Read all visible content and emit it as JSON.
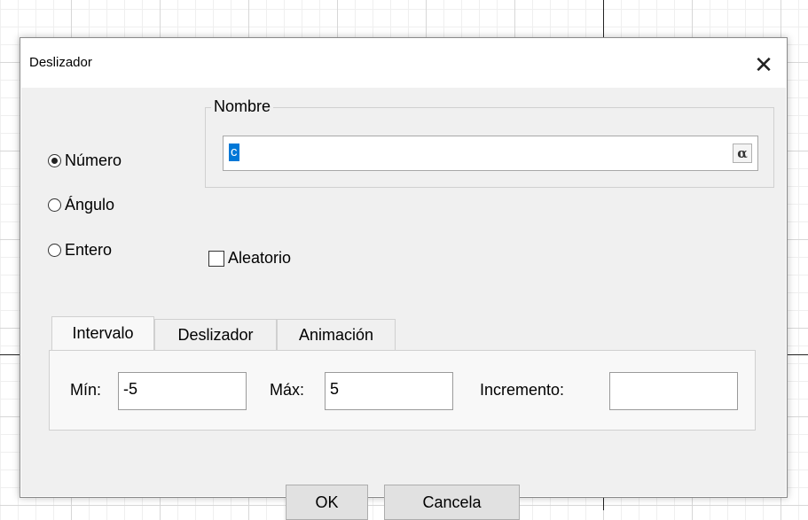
{
  "dialog": {
    "title": "Deslizador",
    "close_glyph": "✕"
  },
  "type_options": [
    {
      "label": "Número",
      "selected": true
    },
    {
      "label": "Ángulo",
      "selected": false
    },
    {
      "label": "Entero",
      "selected": false
    }
  ],
  "name": {
    "legend": "Nombre",
    "value": "c",
    "symbol_button": "α"
  },
  "random": {
    "label": "Aleatorio",
    "checked": false
  },
  "tabs": [
    {
      "label": "Intervalo",
      "active": true
    },
    {
      "label": "Deslizador",
      "active": false
    },
    {
      "label": "Animación",
      "active": false
    }
  ],
  "interval": {
    "min_label": "Mín:",
    "min_value": "-5",
    "max_label": "Máx:",
    "max_value": "5",
    "increment_label": "Incremento:",
    "increment_value": ""
  },
  "buttons": {
    "ok": "OK",
    "cancel": "Cancela"
  },
  "colors": {
    "selection": "#0078d7",
    "dialog_body": "#f0f0f0",
    "grid_major": "#d7d7d7",
    "grid_minor": "#efefef"
  }
}
